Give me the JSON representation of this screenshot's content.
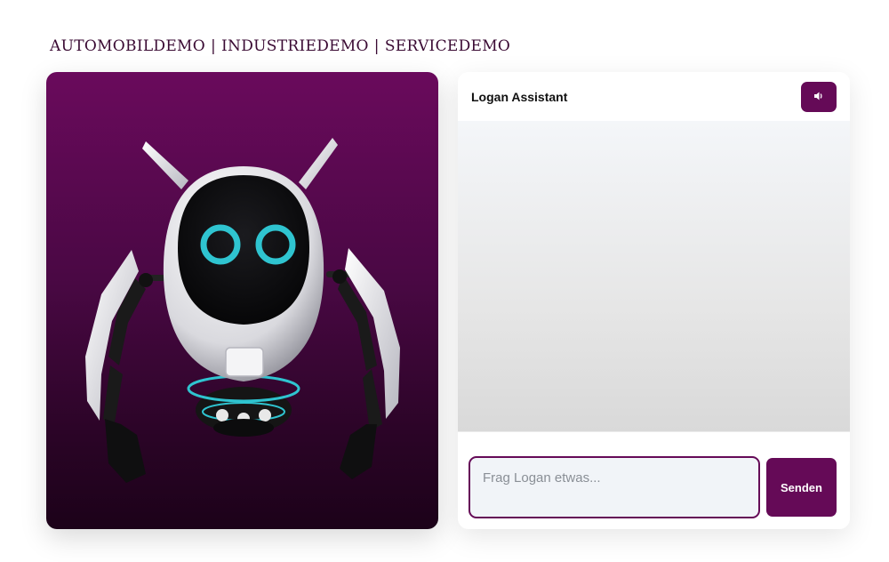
{
  "nav": {
    "items": [
      "AUTOMOBILDEMO",
      "INDUSTRIEDEMO",
      "SERVICEDEMO"
    ],
    "separator": "|"
  },
  "stage": {
    "background_top": "#6a0a5c",
    "background_bottom": "#1c0219",
    "eye_color": "#2fc4d0"
  },
  "chat": {
    "title": "Logan Assistant",
    "sound_icon": "speaker-icon",
    "input_placeholder": "Frag Logan etwas...",
    "input_value": "",
    "send_label": "Senden",
    "accent_color": "#650a57"
  }
}
